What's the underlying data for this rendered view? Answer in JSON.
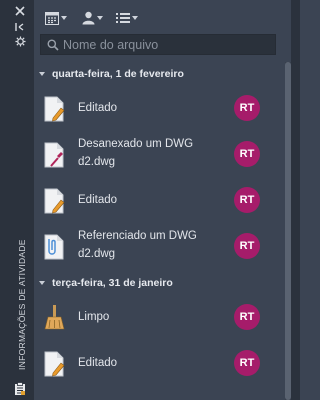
{
  "sidebar": {
    "title": "INFORMAÇÕES DE ATIVIDADE",
    "controls": [
      "close-icon",
      "auto-hide-icon",
      "settings-icon"
    ],
    "bottom_icon": "activity-clipboard-icon"
  },
  "toolbar": {
    "buttons": [
      {
        "icon": "calendar-filter-icon",
        "has_dropdown": true
      },
      {
        "icon": "user-filter-icon",
        "has_dropdown": true
      },
      {
        "icon": "list-view-icon",
        "has_dropdown": true
      }
    ]
  },
  "search": {
    "placeholder": "Nome do arquivo",
    "value": ""
  },
  "groups": [
    {
      "label": "quarta-feira, 1 de fevereiro",
      "items": [
        {
          "icon": "edited-document-icon",
          "text_line1": "Editado",
          "text_line2": "",
          "user": "RT"
        },
        {
          "icon": "detached-document-icon",
          "text_line1": "Desanexado um DWG",
          "text_line2": "d2.dwg",
          "user": "RT"
        },
        {
          "icon": "edited-document-icon",
          "text_line1": "Editado",
          "text_line2": "",
          "user": "RT"
        },
        {
          "icon": "referenced-document-icon",
          "text_line1": "Referenciado um DWG",
          "text_line2": "d2.dwg",
          "user": "RT"
        }
      ]
    },
    {
      "label": "terça-feira, 31 de janeiro",
      "items": [
        {
          "icon": "purge-broom-icon",
          "text_line1": "Limpo",
          "text_line2": "",
          "user": "RT"
        },
        {
          "icon": "edited-document-icon",
          "text_line1": "Editado",
          "text_line2": "",
          "user": "RT"
        }
      ]
    }
  ],
  "colors": {
    "panel_bg": "#3b4453",
    "sidebar_bg": "#2b323d",
    "avatar_bg": "#a61c6a",
    "text": "#e3e6eb"
  }
}
